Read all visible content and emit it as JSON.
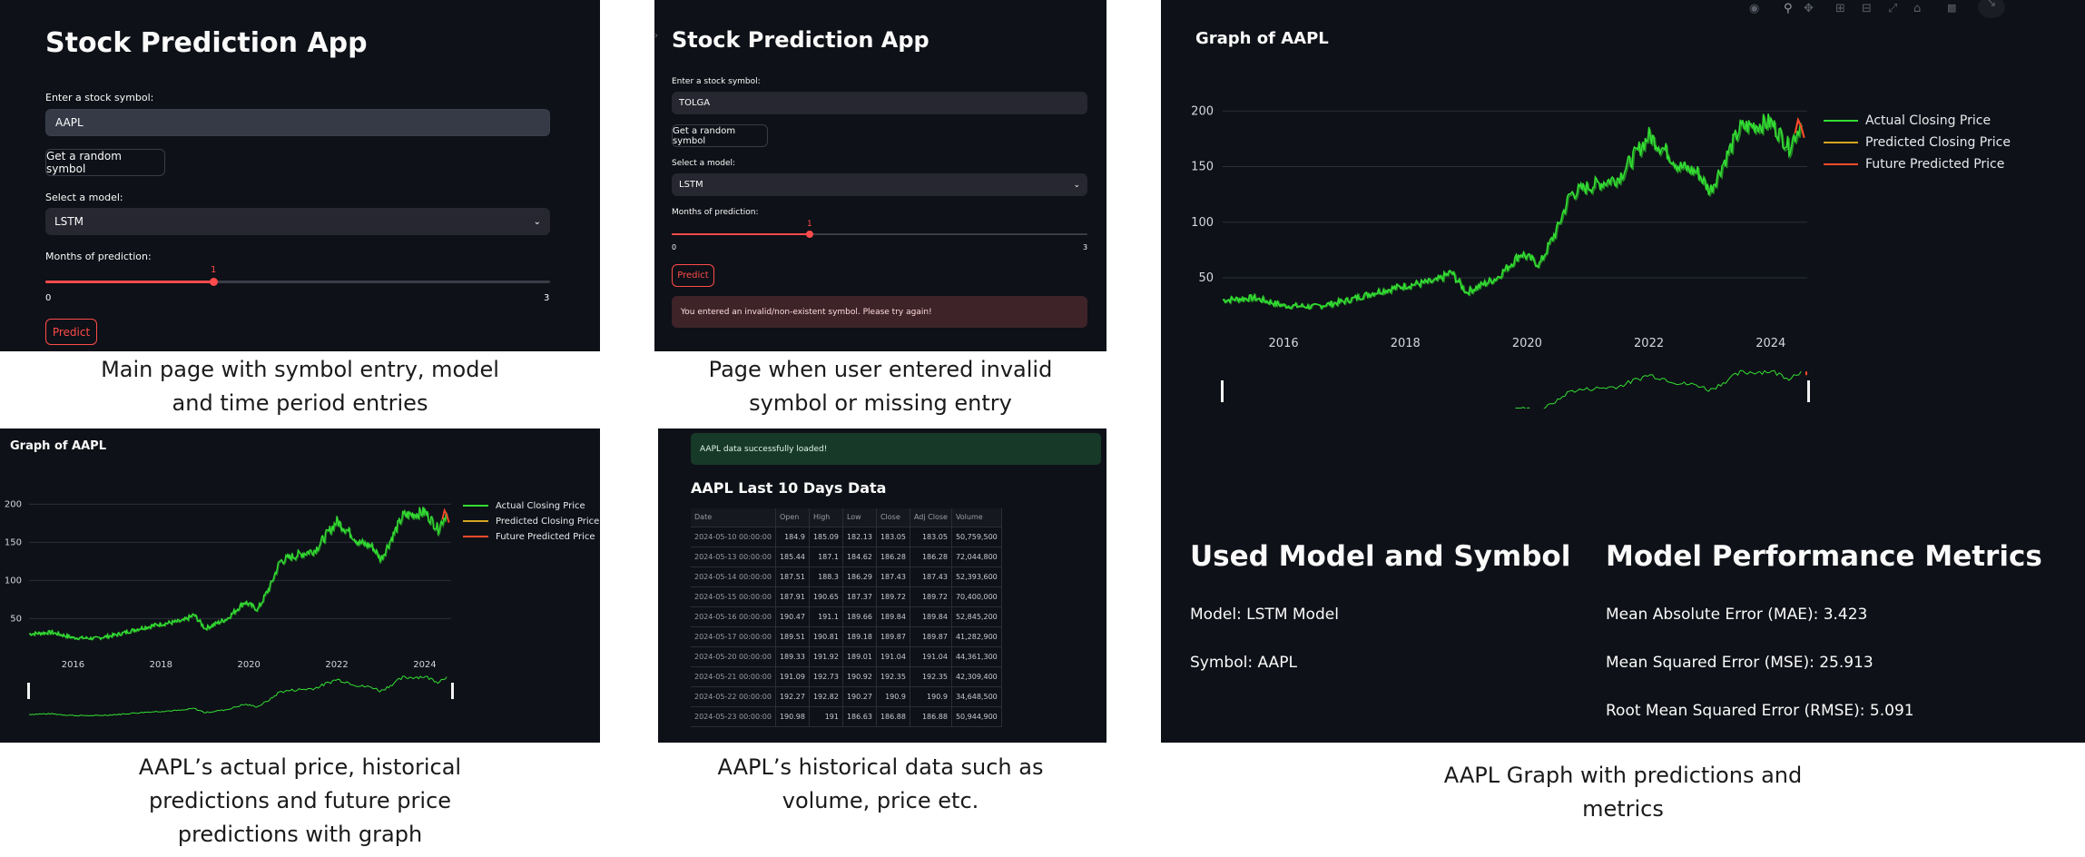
{
  "app": {
    "title": "Stock Prediction App",
    "symbol_label": "Enter a stock symbol:",
    "random_button": "Get a random symbol",
    "model_label": "Select a model:",
    "model_value": "LSTM",
    "months_label": "Months of prediction:",
    "slider_min": "0",
    "slider_max": "3",
    "slider_value": "1",
    "slider_fraction": 0.333,
    "predict_button": "Predict"
  },
  "panel1": {
    "symbol_value": "AAPL"
  },
  "panel2": {
    "symbol_value": "TOLGA",
    "error": "You entered an invalid/non-existent symbol. Please try again!"
  },
  "panel3": {
    "success": "AAPL data successfully loaded!",
    "table_title": "AAPL Last 10 Days Data"
  },
  "table": {
    "headers": [
      "Date",
      "Open",
      "High",
      "Low",
      "Close",
      "Adj Close",
      "Volume"
    ],
    "rows": [
      [
        "2024-05-10 00:00:00",
        "184.9",
        "185.09",
        "182.13",
        "183.05",
        "183.05",
        "50,759,500"
      ],
      [
        "2024-05-13 00:00:00",
        "185.44",
        "187.1",
        "184.62",
        "186.28",
        "186.28",
        "72,044,800"
      ],
      [
        "2024-05-14 00:00:00",
        "187.51",
        "188.3",
        "186.29",
        "187.43",
        "187.43",
        "52,393,600"
      ],
      [
        "2024-05-15 00:00:00",
        "187.91",
        "190.65",
        "187.37",
        "189.72",
        "189.72",
        "70,400,000"
      ],
      [
        "2024-05-16 00:00:00",
        "190.47",
        "191.1",
        "189.66",
        "189.84",
        "189.84",
        "52,845,200"
      ],
      [
        "2024-05-17 00:00:00",
        "189.51",
        "190.81",
        "189.18",
        "189.87",
        "189.87",
        "41,282,900"
      ],
      [
        "2024-05-20 00:00:00",
        "189.33",
        "191.92",
        "189.01",
        "191.04",
        "191.04",
        "44,361,300"
      ],
      [
        "2024-05-21 00:00:00",
        "191.09",
        "192.73",
        "190.92",
        "192.35",
        "192.35",
        "42,309,400"
      ],
      [
        "2024-05-22 00:00:00",
        "192.27",
        "192.82",
        "190.27",
        "190.9",
        "190.9",
        "34,648,500"
      ],
      [
        "2024-05-23 00:00:00",
        "190.98",
        "191",
        "186.63",
        "186.88",
        "186.88",
        "50,944,900"
      ]
    ]
  },
  "graph": {
    "title": "Graph of AAPL"
  },
  "chart_data": {
    "type": "line",
    "title": "Graph of AAPL",
    "xlabel": "",
    "ylabel": "",
    "x_ticks": [
      "2016",
      "2018",
      "2020",
      "2022",
      "2024"
    ],
    "y_ticks": [
      50,
      100,
      150,
      200
    ],
    "ylim": [
      10,
      210
    ],
    "xlim": [
      2015.0,
      2024.6
    ],
    "legend_position": "top-right",
    "grid": true,
    "series": [
      {
        "name": "Actual Closing Price",
        "color": "#33dd33",
        "x": [
          2015.0,
          2015.5,
          2016.0,
          2016.5,
          2017.0,
          2017.5,
          2018.0,
          2018.5,
          2018.75,
          2019.0,
          2019.5,
          2019.9,
          2020.2,
          2020.5,
          2020.7,
          2021.0,
          2021.5,
          2022.0,
          2022.3,
          2022.5,
          2022.8,
          2023.0,
          2023.5,
          2024.0,
          2024.3,
          2024.5
        ],
        "y": [
          30,
          32,
          25,
          24,
          29,
          37,
          43,
          47,
          55,
          37,
          50,
          72,
          62,
          95,
          125,
          132,
          140,
          178,
          163,
          150,
          145,
          128,
          185,
          190,
          168,
          189
        ]
      },
      {
        "name": "Predicted Closing Price",
        "color": "#d4a520",
        "x": [],
        "y": []
      },
      {
        "name": "Future Predicted Price",
        "color": "#ff4b2b",
        "x": [
          2024.4,
          2024.45,
          2024.5,
          2024.55
        ],
        "y": [
          180,
          192,
          186,
          176
        ]
      }
    ]
  },
  "metrics": {
    "used_title": "Used Model and Symbol",
    "model_line": "Model: LSTM Model",
    "symbol_line": "Symbol: AAPL",
    "perf_title": "Model Performance Metrics",
    "mae": "Mean Absolute Error (MAE): 3.423",
    "mse": "Mean Squared Error (MSE): 25.913",
    "rmse": "Root Mean Squared Error (RMSE): 5.091"
  },
  "captions": {
    "c1a": "Main page with symbol entry, model",
    "c1b": "and time period entries",
    "c2a": "Page when user entered invalid",
    "c2b": "symbol or missing entry",
    "c3a": "AAPL’s actual price, historical",
    "c3b": "predictions and future price",
    "c3c": "predictions with graph",
    "c4a": "AAPL’s historical data such as",
    "c4b": "volume, price etc.",
    "c5a": "AAPL Graph with predictions and",
    "c5b": "metrics"
  },
  "toolbar_icons": [
    "camera-icon",
    "zoom-icon",
    "pan-icon",
    "zoom-in-icon",
    "zoom-out-icon",
    "autoscale-icon",
    "home-icon",
    "plotly-logo-icon"
  ]
}
